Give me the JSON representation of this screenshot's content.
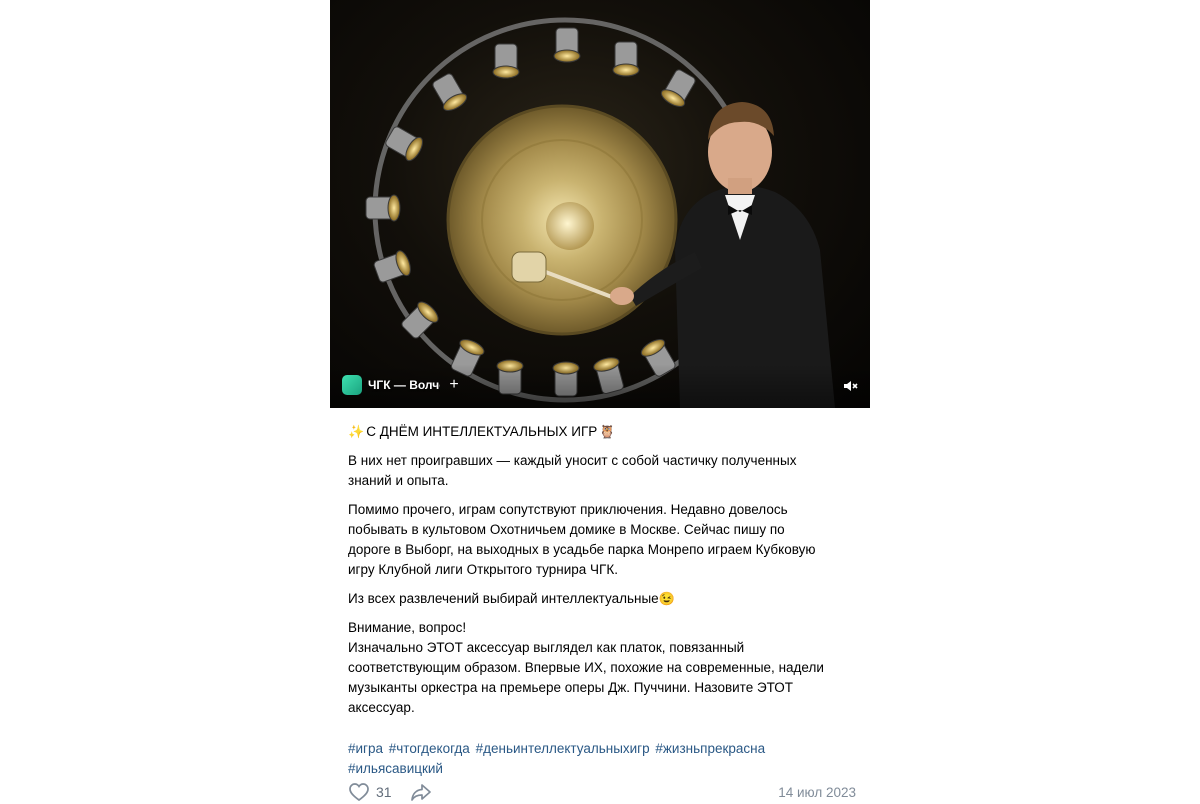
{
  "video": {
    "channel_name": "ЧГК — Волчок",
    "plus_label": "+",
    "mute_icon": "mute-speaker-icon"
  },
  "post": {
    "title": "С ДНЁМ ИНТЕЛЛЕКТУАЛЬНЫХ ИГР",
    "title_emoji_before": "✨",
    "title_emoji_after": "🦉",
    "p1": [
      "В них нет проигравших — каждый уносит с собой частичку полученных",
      "знаний и опыта."
    ],
    "p2": [
      "Помимо прочего, играм сопутствуют приключения. Недавно довелось",
      "побывать в культовом Охотничьем домике в Москве. Сейчас пишу по",
      "дороге в Выборг, на выходных в усадьбе парка Монрепо играем Кубковую",
      "игру Клубной лиги Открытого турнира ЧГК."
    ],
    "p3": "Из всех развлечений выбирай интеллектуальные",
    "p3_emoji": "😉",
    "p4": [
      "Внимание, вопрос!",
      "Изначально ЭТОТ аксессуар выглядел как платок, повязанный",
      "соответствующим образом. Впервые ИХ, похожие на современные, надели",
      "музыканты оркестра на премьере оперы Дж. Пуччини. Назовите ЭТОТ",
      "аксессуар."
    ],
    "tags_line1": [
      "#игра",
      "#чтогдекогда",
      "#деньинтеллектуальныхигр",
      "#жизньпрекрасна"
    ],
    "tags_line2": [
      "#ильясавицкий"
    ]
  },
  "footer": {
    "likes": "31",
    "date": "14 июл 2023",
    "like_icon": "heart-icon",
    "share_icon": "share-icon"
  },
  "colors": {
    "link": "#2a5885",
    "meta": "#818c99",
    "counter": "#626d7a"
  }
}
